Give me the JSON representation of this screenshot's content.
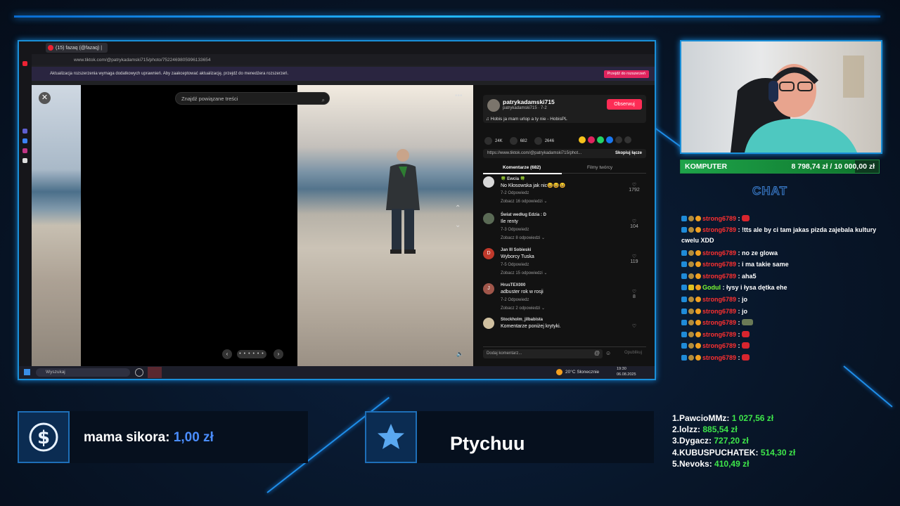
{
  "browser": {
    "tab_title": "(15) fazaq (@fazaq) |",
    "url": "www.tiktok.com/@patrykadamski715/photo/7522469805996133654",
    "notice": "Aktualizacja rozszerzenia wymaga dodatkowych uprawnień. Aby zaakceptować aktualizację, przejdź do menedżera rozszerzeń.",
    "notice_button": "Przejdź do rozszerzeń"
  },
  "viewer": {
    "search_placeholder": "Znajdź powiązane treści",
    "close_icon": "close-icon",
    "dots": "• • • • • •"
  },
  "post": {
    "author": "patrykadamski715",
    "author_sub": "patrykadamski715 · 7-2",
    "follow_label": "Obserwuj",
    "music": "♫  Hobis ja mam urlop a ty nie - HobisPL",
    "likes": "24K",
    "comments_count": "682",
    "saves": "2646",
    "link": "https://www.tiktok.com/@patrykadamski715/phot...",
    "copy_link": "Skopiuj łącze",
    "tab_comments": "Komentarze (682)",
    "tab_creator": "Filmy twórcy",
    "add_comment_placeholder": "Dodaj komentarz...",
    "post_button": "Opublikuj"
  },
  "comments": [
    {
      "name": "🍀 Ewcia 🍀",
      "text": "No Kłosowska jak nic😆😆😆",
      "meta": "7-2      Odpowiedz",
      "more": "Zobacz 16 odpowiedzi ⌄",
      "likes": "1792",
      "color": "#d8d8d8"
    },
    {
      "name": "Świat według Edzia : D",
      "text": "Ile renty",
      "meta": "7-3      Odpowiedz",
      "more": "Zobacz 8 odpowiedzi ⌄",
      "likes": "104",
      "color": "#5a6a55"
    },
    {
      "name": "Jan III Sobieski",
      "text": "Wyborcy Tuska",
      "meta": "7-5      Odpowiedz",
      "more": "Zobacz 15 odpowiedzi ⌄",
      "likes": "119",
      "color": "#c0392b",
      "initial": "D"
    },
    {
      "name": "HrusTEX000",
      "text": "adbuster rok w rosji",
      "meta": "7-2      Odpowiedz",
      "more": "Zobacz 2 odpowiedzi ⌄",
      "likes": "8",
      "color": "#a0564a",
      "initial": "J"
    },
    {
      "name": "Stockholm_jilbabista",
      "text": "Komentarze poniżej krytyki.",
      "meta": "",
      "more": "",
      "likes": "",
      "color": "#d0c0a0"
    }
  ],
  "taskbar": {
    "search": "Wyszukaj",
    "weather": "20°C  Słonecznie",
    "time": "19:30",
    "date": "06.08.2025"
  },
  "goal": {
    "label": "KOMPUTER",
    "amount": "8 798,74 zł / 10 000,00 zł",
    "progress": 0.88
  },
  "chat": {
    "title": "CHAT",
    "messages": [
      {
        "user": "strong6789",
        "text": " : ",
        "emote": "red"
      },
      {
        "user": "strong6789",
        "text": " : !tts ale by ci tam jakas pizda zajebala kultury cwelu XDD",
        "wrap": true
      },
      {
        "user": "strong6789",
        "text": " : no ze glowa"
      },
      {
        "user": "strong6789",
        "text": " : i ma takie same"
      },
      {
        "user": "strong6789",
        "text": " : aha5"
      },
      {
        "user": "Godul",
        "text": " : łysy i łysa dętka ehe",
        "green": true
      },
      {
        "user": "strong6789",
        "text": " : jo"
      },
      {
        "user": "strong6789",
        "text": " : jo"
      },
      {
        "user": "strong6789",
        "text": " : ",
        "emote": "tank"
      },
      {
        "user": "strong6789",
        "text": " : ",
        "emote": "red"
      },
      {
        "user": "strong6789",
        "text": " : ",
        "emote": "red"
      },
      {
        "user": "strong6789",
        "text": " : ",
        "emote": "red"
      }
    ]
  },
  "tip": {
    "name": "mama sikora:",
    "amount": "1,00 zł",
    "icon": "dollar-icon"
  },
  "subscriber": {
    "name": "Ptychuu",
    "icon": "star-icon"
  },
  "top_donors": [
    {
      "rank": "1.",
      "name": "PawcioMMz:",
      "amount": "1 027,56 zł"
    },
    {
      "rank": "2.",
      "name": "lolzz:",
      "amount": "885,54 zł"
    },
    {
      "rank": "3.",
      "name": "Dygacz:",
      "amount": "727,20 zł"
    },
    {
      "rank": "4.",
      "name": "KUBUSPUCHATEK:",
      "amount": "514,30 zł"
    },
    {
      "rank": "5.",
      "name": "Nevoks:",
      "amount": "410,49 zł"
    }
  ],
  "colors": {
    "accent": "#1a8fd8",
    "tiktok_red": "#fe2c55",
    "donor_green": "#3ee64a",
    "chat_red": "#ff3030"
  }
}
